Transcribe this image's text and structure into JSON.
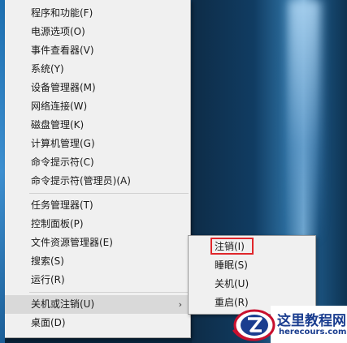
{
  "menu": {
    "items": [
      {
        "label": "程序和功能(F)"
      },
      {
        "label": "电源选项(O)"
      },
      {
        "label": "事件查看器(V)"
      },
      {
        "label": "系统(Y)"
      },
      {
        "label": "设备管理器(M)"
      },
      {
        "label": "网络连接(W)"
      },
      {
        "label": "磁盘管理(K)"
      },
      {
        "label": "计算机管理(G)"
      },
      {
        "label": "命令提示符(C)"
      },
      {
        "label": "命令提示符(管理员)(A)"
      },
      {
        "label": "任务管理器(T)"
      },
      {
        "label": "控制面板(P)"
      },
      {
        "label": "文件资源管理器(E)"
      },
      {
        "label": "搜索(S)"
      },
      {
        "label": "运行(R)"
      },
      {
        "label": "关机或注销(U)",
        "has_submenu": true,
        "active": true
      },
      {
        "label": "桌面(D)"
      }
    ],
    "submenu_arrow": "›"
  },
  "submenu": {
    "items": [
      {
        "label": "注销(I)",
        "highlighted": true
      },
      {
        "label": "睡眠(S)"
      },
      {
        "label": "关机(U)"
      },
      {
        "label": "重启(R)"
      }
    ]
  },
  "watermark": {
    "name": "这里教程网",
    "domain": "herecours.com",
    "icon": "z-logo-icon"
  },
  "colors": {
    "menu_bg": "#f0f0f0",
    "hover_bg": "#d9d9d9",
    "highlight_border": "#e0262b",
    "logo_text": "#1a3d8f"
  }
}
